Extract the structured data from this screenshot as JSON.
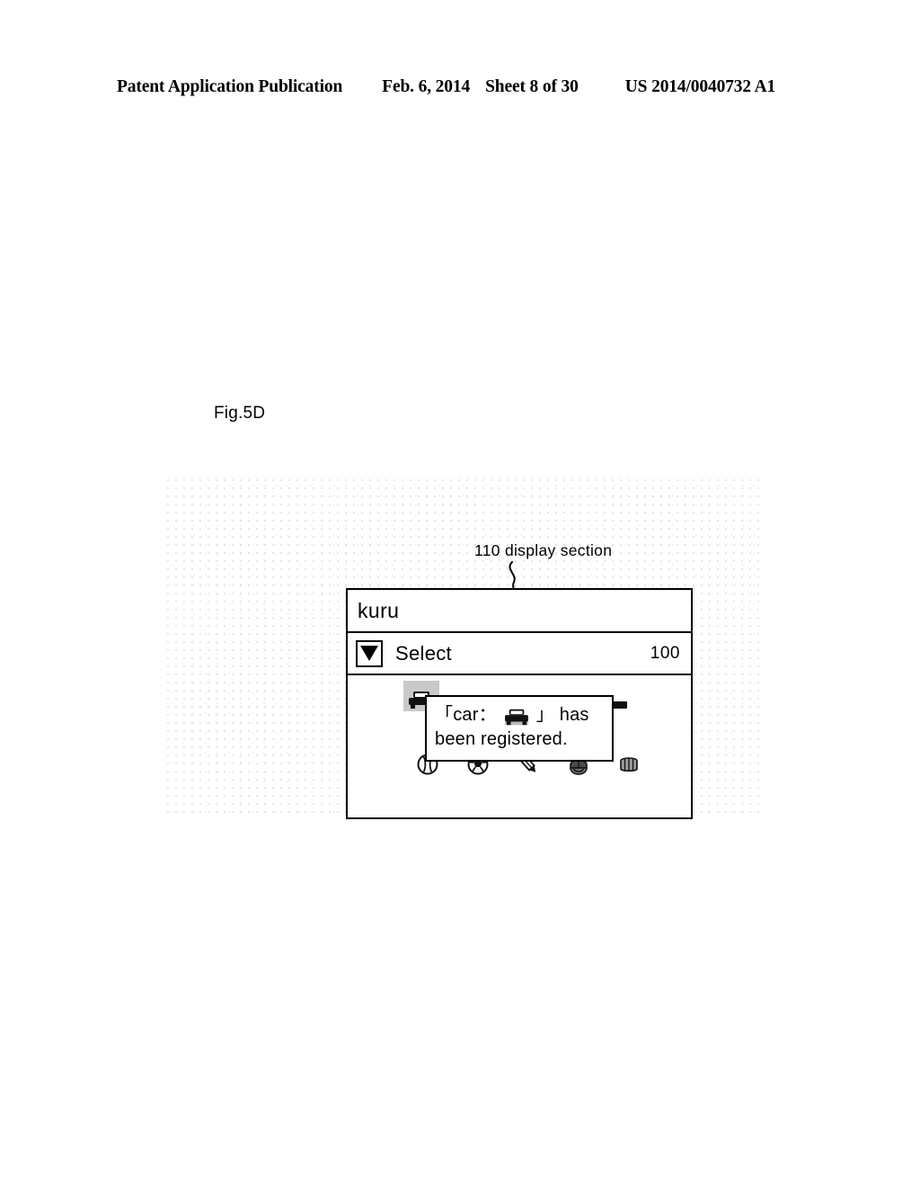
{
  "page_header": {
    "publication": "Patent Application Publication",
    "date": "Feb. 6, 2014",
    "sheet": "Sheet 8 of 30",
    "patent_number": "US 2014/0040732 A1"
  },
  "figure": {
    "label": "Fig.5D"
  },
  "callout": {
    "text": "110 display section",
    "reference_number": "110"
  },
  "display_section": {
    "input_row": {
      "value": "kuru"
    },
    "select_row": {
      "button_icon": "triangle-down-icon",
      "label": "Select",
      "count": "100"
    },
    "candidate_row": {
      "selected_index": 0,
      "items": [
        {
          "icon": "car-front-icon",
          "selected": true
        },
        {
          "icon": "car-side-icon",
          "selected": false
        },
        {
          "icon": "truck-icon",
          "selected": false
        },
        {
          "icon": "small-car-icon",
          "selected": false
        },
        {
          "icon": "van-icon",
          "selected": false
        }
      ]
    },
    "icon_row": {
      "items": [
        {
          "icon": "baseball-icon"
        },
        {
          "icon": "soccer-ball-icon"
        },
        {
          "icon": "pencil-icon"
        },
        {
          "icon": "baseball-helmet-icon"
        },
        {
          "icon": "baseball-glove-icon"
        }
      ]
    },
    "popup": {
      "line1_prefix": "「car：",
      "inline_icon": "car-front-icon",
      "line1_suffix": "」 has",
      "line2": "been registered."
    }
  },
  "colors": {
    "ink": "#000000",
    "paper": "#ffffff",
    "selection_gray": "#c9c9c9",
    "icon_gray": "#5a5a5a"
  }
}
